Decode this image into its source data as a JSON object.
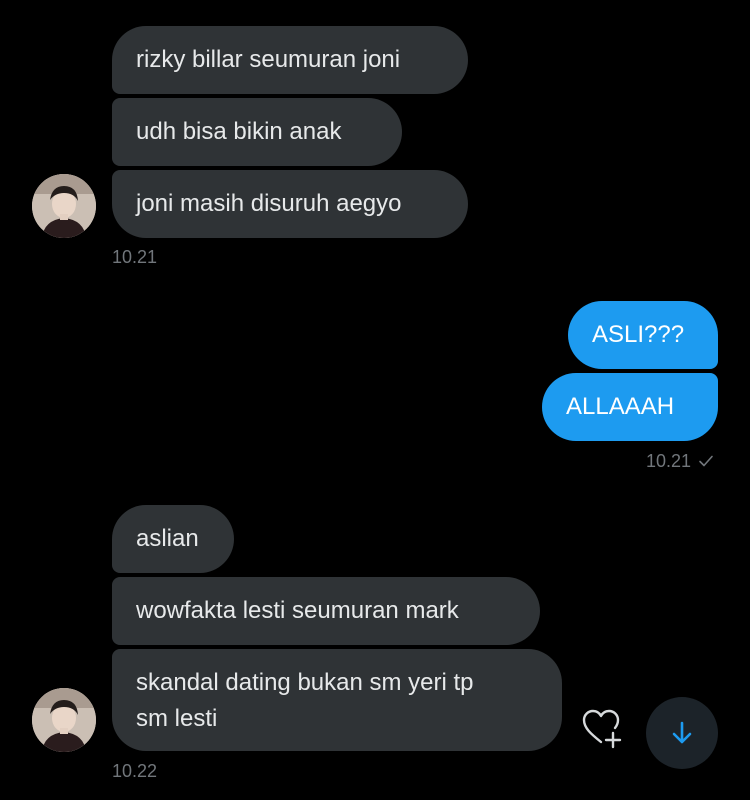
{
  "conversation": {
    "groups": [
      {
        "direction": "incoming",
        "messages": [
          "rizky billar seumuran joni",
          "udh bisa bikin anak",
          "joni masih disuruh aegyo"
        ],
        "time": "10.21"
      },
      {
        "direction": "outgoing",
        "messages": [
          "ASLI???",
          "ALLAAAH"
        ],
        "time": "10.21",
        "status_icon": "checkmark-icon"
      },
      {
        "direction": "incoming",
        "messages": [
          "aslian",
          "wowfakta lesti seumuran mark",
          "skandal dating bukan sm yeri tp\nsm lesti"
        ],
        "time": "10.22"
      }
    ]
  },
  "icons": {
    "reaction": "heart-plus-icon",
    "scroll": "arrow-down-icon",
    "avatar": "user-avatar"
  },
  "colors": {
    "background": "#000000",
    "incoming_bubble": "#2f3336",
    "outgoing_bubble": "#1d9bf0",
    "timestamp": "#71767b",
    "scroll_button_bg": "#1c2329",
    "scroll_arrow": "#1d9bf0"
  }
}
